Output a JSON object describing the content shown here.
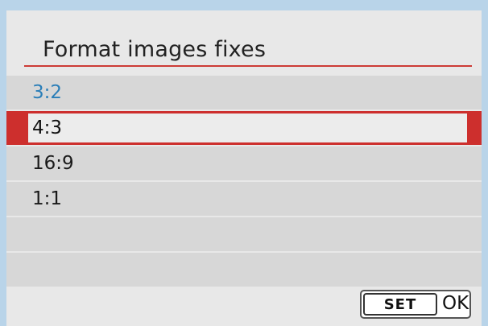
{
  "menu": {
    "title": "Format images fixes",
    "options": [
      {
        "label": "3:2",
        "state": "current"
      },
      {
        "label": "4:3",
        "state": "selected"
      },
      {
        "label": "16:9",
        "state": "normal"
      },
      {
        "label": "1:1",
        "state": "normal"
      },
      {
        "label": "",
        "state": "empty"
      },
      {
        "label": "",
        "state": "empty"
      }
    ]
  },
  "footer": {
    "set_label": "SET",
    "ok_label": "OK"
  },
  "colors": {
    "accent_red": "#cd2f2d",
    "current_blue": "#2a7eb8",
    "background": "#b9d4e9"
  }
}
